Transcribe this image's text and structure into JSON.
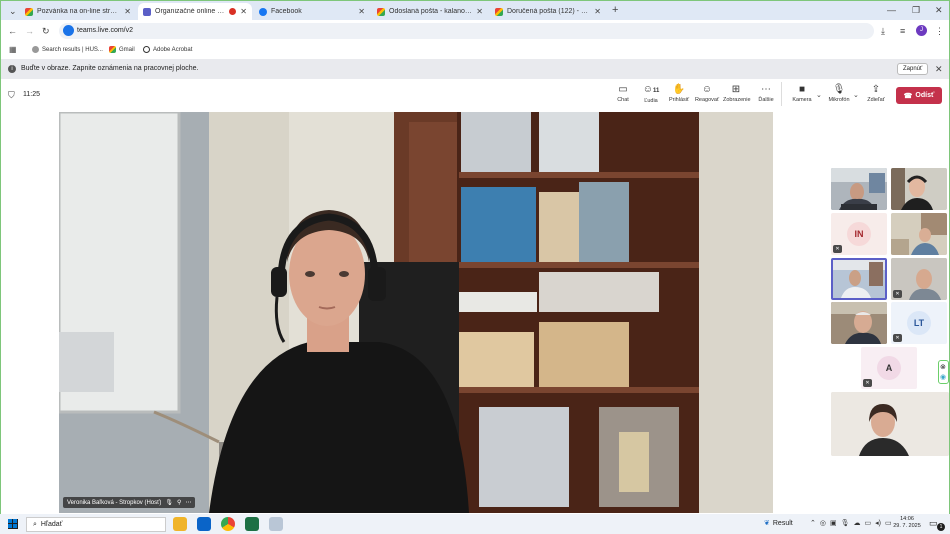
{
  "browser": {
    "tabs": [
      {
        "label": "Pozvánka na on-line stretnutie",
        "icon": "gmail-icon"
      },
      {
        "label": "Organizačné online stretnutie",
        "icon": "teams-icon"
      },
      {
        "label": "Facebook",
        "icon": "facebook-icon"
      },
      {
        "label": "Odoslaná pošta - kalanovajana",
        "icon": "gmail-icon"
      },
      {
        "label": "Doručená pošta (122) - kalanov",
        "icon": "gmail-icon"
      }
    ],
    "url": "teams.live.com/v2",
    "bookmarks": [
      "Search results | HUS...",
      "Gmail",
      "Adobe Acrobat"
    ],
    "profile_initial": "J"
  },
  "notification": {
    "text": "Buďte v obraze. Zapnite oznámenia na pracovnej ploche.",
    "button": "Zapnúť"
  },
  "meeting": {
    "time": "11:25",
    "people_count": "11",
    "buttons": [
      "Chat",
      "Ľudia",
      "Prihlásiť",
      "Reagovať",
      "Zobrazenie",
      "Ďalšie",
      "Kamera",
      "Mikrofón",
      "Zdieľať"
    ],
    "leave_label": "Odísť",
    "speaker_name": "Veronika Baľková - Stropkov (Hosť)",
    "tiles": [
      {
        "type": "video",
        "muted": false
      },
      {
        "type": "video",
        "muted": false
      },
      {
        "type": "avatar",
        "initials": "IN",
        "muted": true,
        "color": "#f6d9d9",
        "text_color": "#a4262c"
      },
      {
        "type": "video",
        "muted": false
      },
      {
        "type": "video",
        "muted": false,
        "active": true
      },
      {
        "type": "video",
        "muted": true
      },
      {
        "type": "video",
        "muted": false
      },
      {
        "type": "avatar",
        "initials": "LT",
        "muted": true,
        "color": "#dbe7f7",
        "text_color": "#2b579a"
      },
      {
        "type": "avatar",
        "initials": "A",
        "muted": true,
        "color": "#f1d9e6",
        "text_color": "#333333"
      },
      {
        "type": "video",
        "muted": false,
        "self": true
      }
    ]
  },
  "taskbar": {
    "search_placeholder": "Hľadať",
    "weather": "Result",
    "clock_time": "14:06",
    "clock_date": "29. 7. 2025",
    "notif_count": "1"
  }
}
